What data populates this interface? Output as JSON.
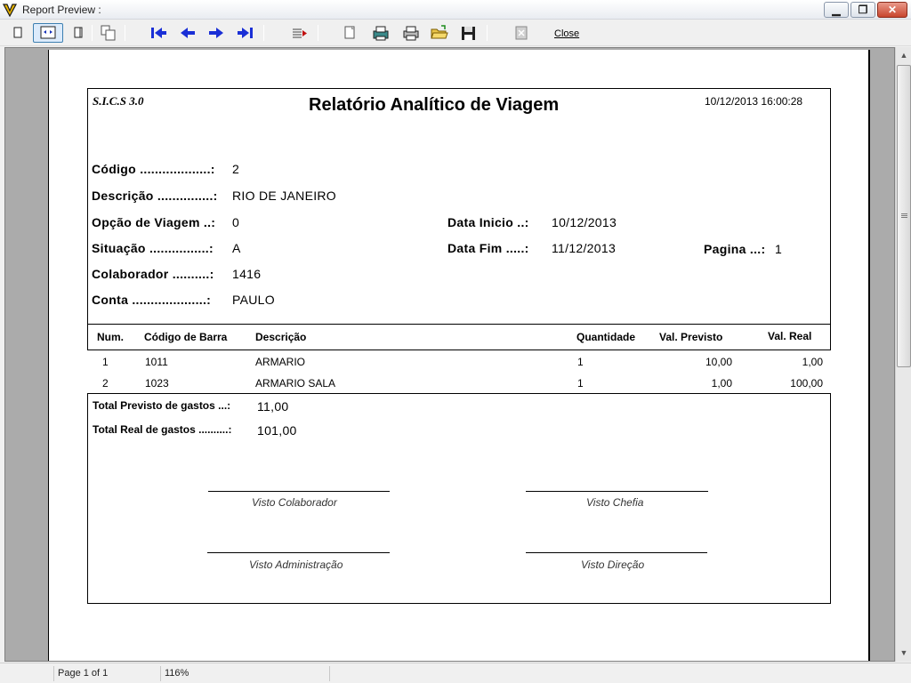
{
  "window": {
    "title": "Report Preview :"
  },
  "toolbar": {
    "close_label": "Close"
  },
  "status": {
    "page": "Page 1 of 1",
    "zoom": "116%"
  },
  "report": {
    "system": "S.I.C.S 3.0",
    "title": "Relatório Analítico de Viagem",
    "datetime": "10/12/2013 16:00:28",
    "fields": {
      "codigo_label": "Código ...................:",
      "codigo_value": "2",
      "descricao_label": "Descrição ...............:",
      "descricao_value": "RIO DE JANEIRO",
      "opcao_label": "Opção de Viagem ..:",
      "opcao_value": "0",
      "situacao_label": "Situação ................:",
      "situacao_value": "A",
      "colaborador_label": "Colaborador ..........:",
      "colaborador_value": "1416",
      "conta_label": "Conta ....................:",
      "conta_value": "PAULO",
      "data_inicio_label": "Data Inicio ..:",
      "data_inicio_value": "10/12/2013",
      "data_fim_label": "Data Fim .....:",
      "data_fim_value": "11/12/2013",
      "pagina_label": "Pagina ...:",
      "pagina_value": "1"
    },
    "table": {
      "headers": [
        "Num.",
        "Código de Barra",
        "Descrição",
        "Quantidade",
        "Val. Previsto",
        "Val. Real"
      ],
      "rows": [
        [
          "1",
          "1011",
          "ARMARIO",
          "1",
          "10,00",
          "1,00"
        ],
        [
          "2",
          "1023",
          "ARMARIO SALA",
          "1",
          "1,00",
          "100,00"
        ]
      ]
    },
    "totals": {
      "previsto_label": "Total Previsto de gastos ...:",
      "previsto_value": "11,00",
      "real_label": "Total Real de gastos ..........:",
      "real_value": "101,00"
    },
    "signatures": [
      "Visto Colaborador",
      "Visto Chefia",
      "Visto Administração",
      "Visto Direção"
    ]
  }
}
